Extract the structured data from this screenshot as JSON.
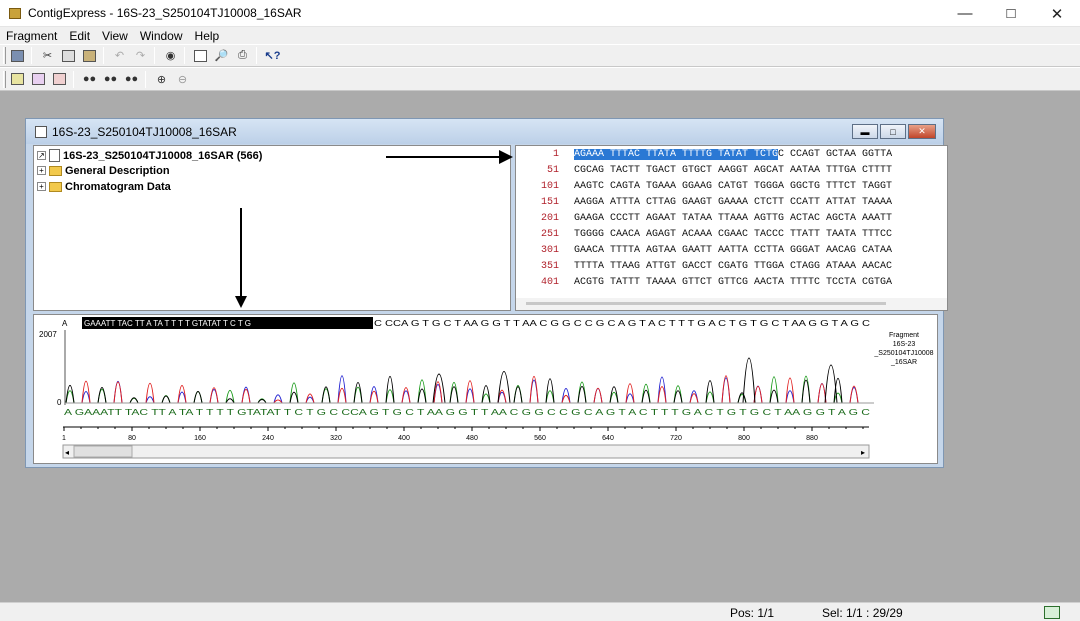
{
  "app": {
    "window_title": "ContigExpress - 16S-23_S250104TJ10008_16SAR",
    "menu": [
      "Fragment",
      "Edit",
      "View",
      "Window",
      "Help"
    ]
  },
  "child_window": {
    "title": "16S-23_S250104TJ10008_16SAR"
  },
  "tree": {
    "items": [
      {
        "label": "16S-23_S250104TJ10008_16SAR (566)",
        "expander": "↗"
      },
      {
        "label": "General Description",
        "expander": "+"
      },
      {
        "label": "Chromatogram Data",
        "expander": "+"
      }
    ]
  },
  "sequence": {
    "rows": [
      {
        "num": "1",
        "highlighted": "AGAAA TTTAC TTATA TTTTG TATAT TCTG",
        "text": "C CCAGT GCTAA GGTTA"
      },
      {
        "num": "51",
        "text": "CGCAG TACTT TGACT GTGCT AAGGT AGCAT AATAA TTTGA CTTTT"
      },
      {
        "num": "101",
        "text": "AAGTC CAGTA TGAAA GGAAG CATGT TGGGA GGCTG TTTCT TAGGT"
      },
      {
        "num": "151",
        "text": "AAGGA ATTTA CTTAG GAAGT GAAAA CTCTT CCATT ATTAT TAAAA"
      },
      {
        "num": "201",
        "text": "GAAGA CCCTT AGAAT TATAA TTAAA AGTTG ACTAC AGCTA AAATT"
      },
      {
        "num": "251",
        "text": "TGGGG CAACA AGAGT ACAAA CGAAC TACCC TTATT TAATA TTTCC"
      },
      {
        "num": "301",
        "text": "GAACA TTTTA AGTAA GAATT AATTA CCTTA GGGAT AACAG CATAA"
      },
      {
        "num": "351",
        "text": "TTTTA TTAAG ATTGT GACCT CGATG TTGGA CTAGG ATAAA AACAC"
      },
      {
        "num": "401",
        "text": "ACGTG TATTT TAAAA GTTCT GTTCG AACTA TTTTC TCCTA CGTGA"
      }
    ]
  },
  "chromatogram": {
    "top_prefix": "A",
    "top_selected": "GAAATT TAC    TT  A  TA  T  T T T   GTATAT  T C T G",
    "top_rest": "C CCA G T G C T AA G G T T AA C G G C C G C A G T A C T T T G A C T G T G C T AA G G T A G C",
    "ymax_label": "2007",
    "ymin_label": "0",
    "bottom_seq": "A  GAAATT  TAC     TT   A   TA   T  T T T    GTATAT  T C T  G C CCA  G T G C T AA G G T T AA C G G C C G C A G T A C T T T G A C T G T G C T AA G G T A G C",
    "fragment_label": [
      "Fragment",
      "16S-23",
      "_S250104TJ10008",
      "_16SAR"
    ],
    "scale_ticks": [
      "1",
      "80",
      "160",
      "240",
      "320",
      "400",
      "480",
      "560",
      "640",
      "720",
      "800",
      "880"
    ],
    "colors": {
      "A": "#1a9a1a",
      "C": "#2020d0",
      "G": "#000000",
      "T": "#e02020"
    }
  },
  "status": {
    "pos": "Pos: 1/1",
    "sel": "Sel: 1/1 : 29/29"
  }
}
